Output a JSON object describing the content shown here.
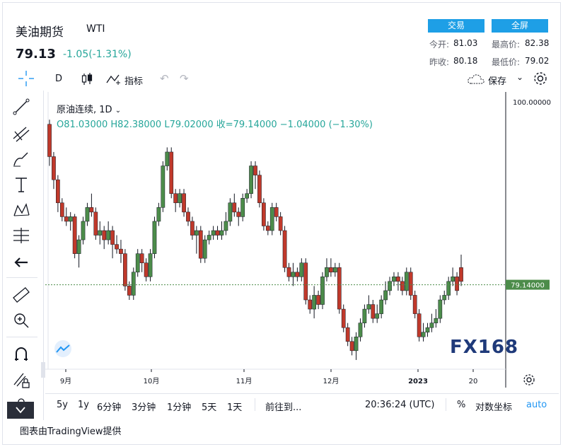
{
  "header": {
    "title": "美油期货",
    "symbol": "WTI",
    "price": "79.13",
    "change": "-1.05(-1.31%)",
    "trade_label": "交易",
    "fullscreen_label": "全屏",
    "stats": [
      {
        "label": "今开:",
        "value": "81.03"
      },
      {
        "label": "最高价:",
        "value": "82.38"
      },
      {
        "label": "昨收:",
        "value": "80.18"
      },
      {
        "label": "最低价:",
        "value": "79.02"
      }
    ]
  },
  "toolbar": {
    "interval": "D",
    "indicators_label": "指标",
    "save_label": "保存"
  },
  "legend": {
    "name": "原油连续",
    "interval": "1D",
    "ohlc": "O81.03000  H82.38000  L79.02000  收=79.14000  −1.04000 (−1.30%)"
  },
  "axis": {
    "y_top_label": "100.00000",
    "last_price_label": "79.14000"
  },
  "bottom_bar": {
    "ranges": [
      "5y",
      "1y",
      "6分钟",
      "3分钟",
      "1分钟",
      "5天",
      "1天"
    ],
    "goto_label": "前往到...",
    "time": "20:36:24 (UTC)",
    "percent_label": "%",
    "log_label": "对数坐标",
    "auto_label": "auto"
  },
  "watermark": "FX168",
  "credit": "图表由TradingView提供",
  "colors": {
    "up": "#4c8c4a",
    "down": "#c0392b",
    "accent": "#2196f3",
    "change": "#26a69a"
  },
  "chart_data": {
    "type": "candlestick",
    "title": "原油连续, 1D",
    "x_ticks": [
      "9月",
      "10月",
      "11月",
      "12月",
      "2023",
      "20"
    ],
    "ylim": [
      70,
      100
    ],
    "last_price": 79.14,
    "candles": [
      [
        96.5,
        93.0,
        97.0,
        92.0
      ],
      [
        93.0,
        90.5,
        93.5,
        89.5
      ],
      [
        90.5,
        88.0,
        91.0,
        87.0
      ],
      [
        88.0,
        86.5,
        88.5,
        86.0
      ],
      [
        86.5,
        86.0,
        87.5,
        85.5
      ],
      [
        86.0,
        86.5,
        87.0,
        85.0
      ],
      [
        86.5,
        82.5,
        86.8,
        82.0
      ],
      [
        82.5,
        84.0,
        84.5,
        81.0
      ],
      [
        84.0,
        86.0,
        86.5,
        83.5
      ],
      [
        86.0,
        87.5,
        88.0,
        85.5
      ],
      [
        87.5,
        87.0,
        89.0,
        86.5
      ],
      [
        87.0,
        84.5,
        87.5,
        84.0
      ],
      [
        84.5,
        85.0,
        86.0,
        83.5
      ],
      [
        85.0,
        84.0,
        85.5,
        83.0
      ],
      [
        84.0,
        85.0,
        86.0,
        83.5
      ],
      [
        85.0,
        83.5,
        85.5,
        82.0
      ],
      [
        83.5,
        83.0,
        84.5,
        82.5
      ],
      [
        83.0,
        82.5,
        84.0,
        81.5
      ],
      [
        82.5,
        79.0,
        83.0,
        78.5
      ],
      [
        79.0,
        78.0,
        79.5,
        77.5
      ],
      [
        78.0,
        80.5,
        81.0,
        77.5
      ],
      [
        80.5,
        82.5,
        83.0,
        80.0
      ],
      [
        82.5,
        81.5,
        83.0,
        80.5
      ],
      [
        81.5,
        80.0,
        82.0,
        79.5
      ],
      [
        80.0,
        82.5,
        83.0,
        79.5
      ],
      [
        82.5,
        86.0,
        86.5,
        82.0
      ],
      [
        86.0,
        87.5,
        88.0,
        85.5
      ],
      [
        87.5,
        92.0,
        92.5,
        87.0
      ],
      [
        92.0,
        93.5,
        94.0,
        91.5
      ],
      [
        93.5,
        89.0,
        94.0,
        88.5
      ],
      [
        89.0,
        88.0,
        89.5,
        87.0
      ],
      [
        88.0,
        89.0,
        89.5,
        87.5
      ],
      [
        89.0,
        87.0,
        89.5,
        86.5
      ],
      [
        87.0,
        86.0,
        87.5,
        85.5
      ],
      [
        86.0,
        84.5,
        86.5,
        84.0
      ],
      [
        84.5,
        85.0,
        85.5,
        82.5
      ],
      [
        85.0,
        82.0,
        85.5,
        81.5
      ],
      [
        82.0,
        84.0,
        84.5,
        81.5
      ],
      [
        84.0,
        84.5,
        85.0,
        83.5
      ],
      [
        84.5,
        85.0,
        85.5,
        84.0
      ],
      [
        85.0,
        84.5,
        85.5,
        84.0
      ],
      [
        84.5,
        85.0,
        86.0,
        84.0
      ],
      [
        85.0,
        86.0,
        87.0,
        84.5
      ],
      [
        86.0,
        88.0,
        88.5,
        85.5
      ],
      [
        88.0,
        87.0,
        89.0,
        86.5
      ],
      [
        87.0,
        86.5,
        87.5,
        85.5
      ],
      [
        86.5,
        88.5,
        89.0,
        86.0
      ],
      [
        88.5,
        89.0,
        89.5,
        88.0
      ],
      [
        89.0,
        92.0,
        92.5,
        88.5
      ],
      [
        92.0,
        91.0,
        92.5,
        89.5
      ],
      [
        91.0,
        88.0,
        91.5,
        87.5
      ],
      [
        88.0,
        85.5,
        88.5,
        85.0
      ],
      [
        85.5,
        85.0,
        86.0,
        84.5
      ],
      [
        85.0,
        87.5,
        88.0,
        84.5
      ],
      [
        87.5,
        86.5,
        88.0,
        86.0
      ],
      [
        86.5,
        85.0,
        87.0,
        84.5
      ],
      [
        85.0,
        81.0,
        85.5,
        80.5
      ],
      [
        81.0,
        80.0,
        81.5,
        79.5
      ],
      [
        80.0,
        80.5,
        81.5,
        79.0
      ],
      [
        80.5,
        80.0,
        81.0,
        79.5
      ],
      [
        80.0,
        81.5,
        82.0,
        79.5
      ],
      [
        81.5,
        77.5,
        82.0,
        77.0
      ],
      [
        77.5,
        76.5,
        78.0,
        76.0
      ],
      [
        76.5,
        78.0,
        79.0,
        75.5
      ],
      [
        78.0,
        77.0,
        78.5,
        76.5
      ],
      [
        77.0,
        80.0,
        80.5,
        76.5
      ],
      [
        80.0,
        81.0,
        82.0,
        79.5
      ],
      [
        81.0,
        80.5,
        82.0,
        80.0
      ],
      [
        80.5,
        81.0,
        81.5,
        80.0
      ],
      [
        81.0,
        76.5,
        81.5,
        76.0
      ],
      [
        76.5,
        74.5,
        77.0,
        74.0
      ],
      [
        74.5,
        73.0,
        75.0,
        72.5
      ],
      [
        73.0,
        72.0,
        73.5,
        71.5
      ],
      [
        72.0,
        73.5,
        74.0,
        71.0
      ],
      [
        73.5,
        75.0,
        75.5,
        73.0
      ],
      [
        75.0,
        76.5,
        77.0,
        74.5
      ],
      [
        76.5,
        77.0,
        78.0,
        76.0
      ],
      [
        77.0,
        75.5,
        77.5,
        75.0
      ],
      [
        75.5,
        76.0,
        77.0,
        75.0
      ],
      [
        76.0,
        77.5,
        78.0,
        75.5
      ],
      [
        77.5,
        78.5,
        79.5,
        77.0
      ],
      [
        78.5,
        79.5,
        80.0,
        78.0
      ],
      [
        79.5,
        80.0,
        80.5,
        79.0
      ],
      [
        80.0,
        79.5,
        80.5,
        78.5
      ],
      [
        79.5,
        78.5,
        80.0,
        78.0
      ],
      [
        78.5,
        80.5,
        81.0,
        78.0
      ],
      [
        80.5,
        78.0,
        81.0,
        77.5
      ],
      [
        78.0,
        76.0,
        78.5,
        75.5
      ],
      [
        76.0,
        73.5,
        76.5,
        73.0
      ],
      [
        73.5,
        74.0,
        75.0,
        73.0
      ],
      [
        74.0,
        74.5,
        75.0,
        73.5
      ],
      [
        74.5,
        75.0,
        76.0,
        74.0
      ],
      [
        75.0,
        75.5,
        76.5,
        74.5
      ],
      [
        75.5,
        77.5,
        78.0,
        75.0
      ],
      [
        77.5,
        78.0,
        78.5,
        77.0
      ],
      [
        78.0,
        79.5,
        80.0,
        77.5
      ],
      [
        79.5,
        80.0,
        81.0,
        79.0
      ],
      [
        80.0,
        78.5,
        80.5,
        78.0
      ],
      [
        81.0,
        79.5,
        82.4,
        79.0
      ]
    ]
  }
}
